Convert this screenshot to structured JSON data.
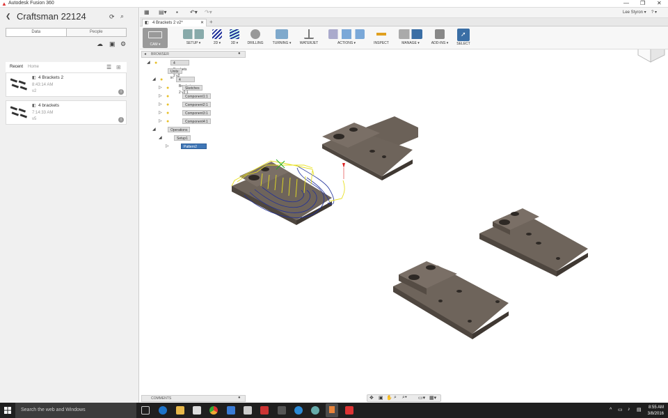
{
  "window": {
    "title": "Autodesk Fusion 360",
    "controls": [
      "—",
      "❐",
      "✕"
    ]
  },
  "data_panel": {
    "project_title": "Craftsman 22124",
    "tabs": [
      {
        "label": "Data",
        "active": true
      },
      {
        "label": "People",
        "active": false
      }
    ],
    "recent_label": "Recent",
    "breadcrumb": "Home",
    "files": [
      {
        "name": "4 Brackets 2",
        "time": "8:43:14 AM",
        "version": "v2"
      },
      {
        "name": "4 brackets",
        "time": "7:14:33 AM",
        "version": "v5"
      }
    ]
  },
  "app_bar": {
    "user": "Lee Styron ▾",
    "help": "? ▾"
  },
  "document_tab": {
    "label": "4 Brackets 2 v2*"
  },
  "toolbar": {
    "workspace": "CAM ▾",
    "groups": [
      {
        "label": "SETUP ▾"
      },
      {
        "label": "2D ▾"
      },
      {
        "label": "3D ▾"
      },
      {
        "label": "DRILLING"
      },
      {
        "label": "TURNING ▾"
      },
      {
        "label": "WATERJET"
      },
      {
        "label": "ACTIONS ▾"
      },
      {
        "label": "INSPECT"
      },
      {
        "label": "MANAGE ▾"
      },
      {
        "label": "ADD-INS ▾"
      },
      {
        "label": "SELECT"
      }
    ]
  },
  "browser": {
    "header": "BROWSER",
    "nodes": [
      {
        "label": "4 Brackets 2 v2",
        "level": 0
      },
      {
        "label": "Units: in",
        "level": 1
      },
      {
        "label": "4 Brackets 2 v2:1",
        "level": 1
      },
      {
        "label": "Sketches",
        "level": 2
      },
      {
        "label": "Component1:1",
        "level": 2
      },
      {
        "label": "Component2:1",
        "level": 2
      },
      {
        "label": "Component3:1",
        "level": 2
      },
      {
        "label": "Component4:1",
        "level": 2
      },
      {
        "label": "Operations",
        "level": 1
      },
      {
        "label": "Setup1",
        "level": 2
      },
      {
        "label": "Pattern2 [Component]",
        "level": 3
      }
    ]
  },
  "comments": {
    "label": "COMMENTS"
  },
  "taskbar": {
    "search_placeholder": "Search the web and Windows",
    "time": "8:55 AM",
    "date": "3/8/2016"
  },
  "colors": {
    "part": "#6b6158",
    "part_dark": "#4e463f",
    "toolpath_blue": "#1f2f9a",
    "toolpath_yellow": "#e8e020",
    "accent": "#3f76b6"
  }
}
